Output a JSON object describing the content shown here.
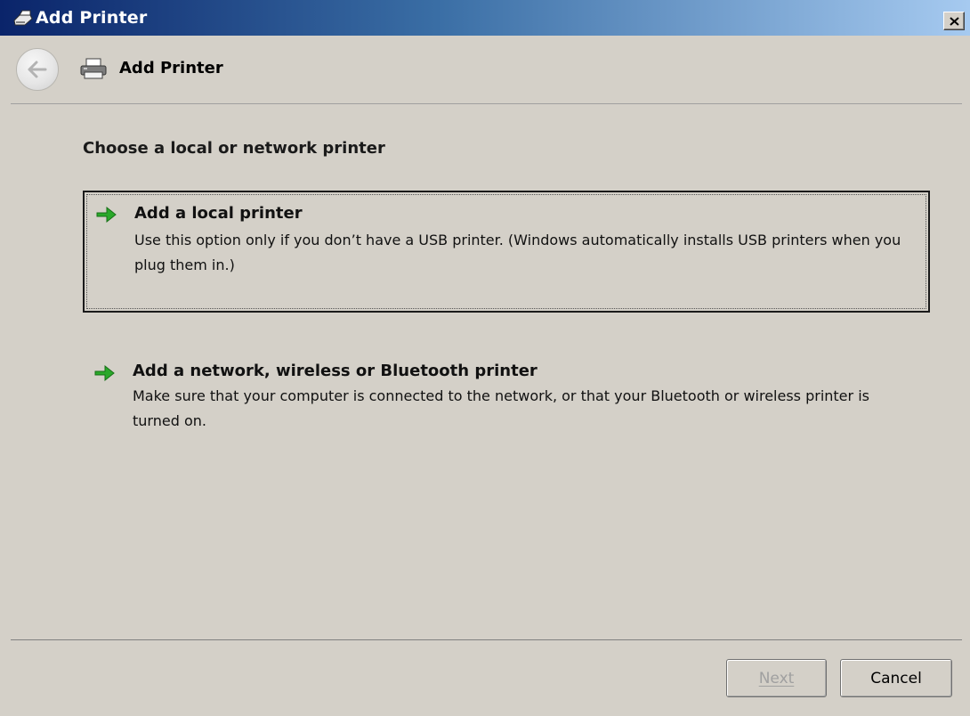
{
  "window": {
    "title": "Add Printer",
    "close_glyph": "×"
  },
  "header": {
    "title": "Add Printer",
    "back_icon": "back-arrow-icon",
    "printer_icon": "printer-icon"
  },
  "content": {
    "heading": "Choose a local or network printer",
    "options": [
      {
        "title": "Add a local printer",
        "description": "Use this option only if you don’t have a USB printer. (Windows automatically installs USB printers when you plug them in.)",
        "icon": "green-arrow-icon",
        "selected": true
      },
      {
        "title": "Add a network, wireless or Bluetooth printer",
        "description": "Make sure that your computer is connected to the network, or that your Bluetooth or wireless printer is turned on.",
        "icon": "green-arrow-icon",
        "selected": false
      }
    ]
  },
  "footer": {
    "next_label": "Next",
    "next_enabled": false,
    "cancel_label": "Cancel"
  },
  "colors": {
    "titlebar_start": "#0a246a",
    "titlebar_end": "#a6caf0",
    "panel_bg": "#d4d0c8",
    "arrow_green": "#2aa82a"
  }
}
